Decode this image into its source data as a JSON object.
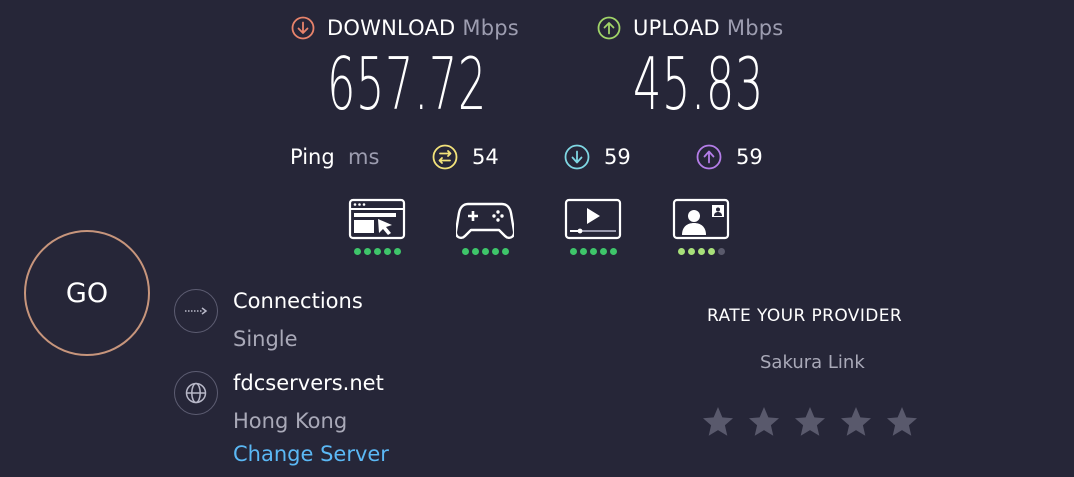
{
  "download": {
    "label": "DOWNLOAD",
    "unit": "Mbps",
    "value": "657.72",
    "color": "#e8836b",
    "icon": "arrow-down-circle-icon"
  },
  "upload": {
    "label": "UPLOAD",
    "unit": "Mbps",
    "value": "45.83",
    "color": "#a0d468",
    "icon": "arrow-up-circle-icon"
  },
  "ping": {
    "label": "Ping",
    "unit": "ms",
    "idle": {
      "value": "54",
      "color": "#f2e27a",
      "icon": "idle-ping-icon"
    },
    "download": {
      "value": "59",
      "color": "#7fd7e3",
      "icon": "download-ping-icon"
    },
    "upload": {
      "value": "59",
      "color": "#b47de8",
      "icon": "upload-ping-icon"
    }
  },
  "experience": [
    {
      "name": "web-browsing",
      "icon": "browser-cursor-icon",
      "rating": 5,
      "max": 5
    },
    {
      "name": "gaming",
      "icon": "gamepad-icon",
      "rating": 5,
      "max": 5
    },
    {
      "name": "video-streaming",
      "icon": "video-player-icon",
      "rating": 5,
      "max": 5
    },
    {
      "name": "video-chat",
      "icon": "video-chat-icon",
      "rating": 4,
      "max": 5
    }
  ],
  "go_label": "GO",
  "connections": {
    "title": "Connections",
    "value": "Single",
    "icon": "connections-arrow-icon"
  },
  "server": {
    "title": "fdcservers.net",
    "location": "Hong Kong",
    "change_label": "Change Server",
    "icon": "globe-icon"
  },
  "rate": {
    "title": "RATE YOUR PROVIDER",
    "provider": "Sakura Link",
    "stars": 5
  }
}
